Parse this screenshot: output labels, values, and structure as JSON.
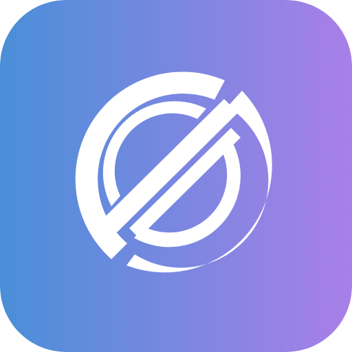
{
  "icon": {
    "name": "app-logo-icon",
    "gradient_start": "#4A8FD8",
    "gradient_end": "#A97FE8",
    "glyph_color": "#FFFFFF"
  }
}
